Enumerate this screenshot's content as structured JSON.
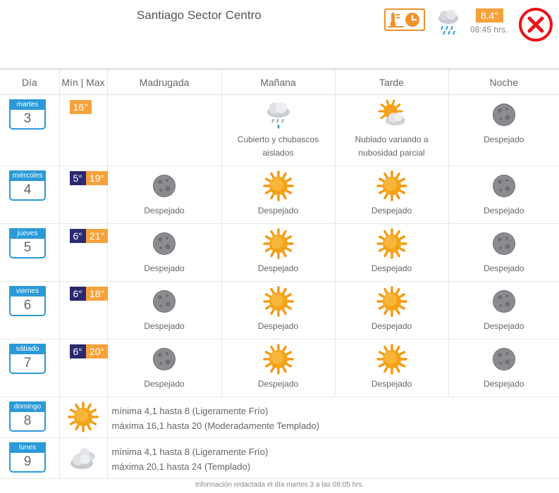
{
  "header": {
    "location": "Santiago Sector Centro",
    "current_temp": "8.4°",
    "current_time": "08:45 hrs.",
    "thermo_icon": "thermometer-clock-icon",
    "current_icon": "rain-cloud-icon",
    "close_icon": "close-icon",
    "accent_color": "#f6a23b",
    "close_color": "#e8141c"
  },
  "columns": [
    "Día",
    "Mín | Max",
    "Madrugada",
    "Mañana",
    "Tarde",
    "Noche"
  ],
  "rows": [
    {
      "day": "martes",
      "num": "3",
      "min": "",
      "max": "16°",
      "periods": [
        {
          "icon": "",
          "desc": ""
        },
        {
          "icon": "rain-cloud-icon",
          "desc": "Cubierto y chubascos aislados"
        },
        {
          "icon": "sun-cloud-icon",
          "desc": "Nublado variando a nubosidad parcial"
        },
        {
          "icon": "moon-icon",
          "desc": "Despejado"
        }
      ]
    },
    {
      "day": "miércoles",
      "num": "4",
      "min": "5°",
      "max": "19°",
      "periods": [
        {
          "icon": "moon-icon",
          "desc": "Despejado"
        },
        {
          "icon": "sun-icon",
          "desc": "Despejado"
        },
        {
          "icon": "sun-icon",
          "desc": "Despejado"
        },
        {
          "icon": "moon-icon",
          "desc": "Despejado"
        }
      ]
    },
    {
      "day": "jueves",
      "num": "5",
      "min": "6°",
      "max": "21°",
      "periods": [
        {
          "icon": "moon-icon",
          "desc": "Despejado"
        },
        {
          "icon": "sun-icon",
          "desc": "Despejado"
        },
        {
          "icon": "sun-icon",
          "desc": "Despejado"
        },
        {
          "icon": "moon-icon",
          "desc": "Despejado"
        }
      ]
    },
    {
      "day": "viernes",
      "num": "6",
      "min": "6°",
      "max": "18°",
      "periods": [
        {
          "icon": "moon-icon",
          "desc": "Despejado"
        },
        {
          "icon": "sun-icon",
          "desc": "Despejado"
        },
        {
          "icon": "sun-icon",
          "desc": "Despejado"
        },
        {
          "icon": "moon-icon",
          "desc": "Despejado"
        }
      ]
    },
    {
      "day": "sábado",
      "num": "7",
      "min": "6°",
      "max": "20°",
      "periods": [
        {
          "icon": "moon-icon",
          "desc": "Despejado"
        },
        {
          "icon": "sun-icon",
          "desc": "Despejado"
        },
        {
          "icon": "sun-icon",
          "desc": "Despejado"
        },
        {
          "icon": "moon-icon",
          "desc": "Despejado"
        }
      ]
    }
  ],
  "extended": [
    {
      "day": "domingo",
      "num": "8",
      "icon": "sun-icon",
      "line1": "mínima 4,1 hasta 8 (Ligeramente Frío)",
      "line2": "máxima 16,1 hasta 20 (Moderadamente Templado)"
    },
    {
      "day": "lunes",
      "num": "9",
      "icon": "cloudy-icon",
      "line1": "mínima 4,1 hasta 8 (Ligeramente Frío)",
      "line2": "máxima 20,1 hasta 24 (Templado)"
    }
  ],
  "footer": "Información redactada el día martes 3 a las 08:05 hrs."
}
